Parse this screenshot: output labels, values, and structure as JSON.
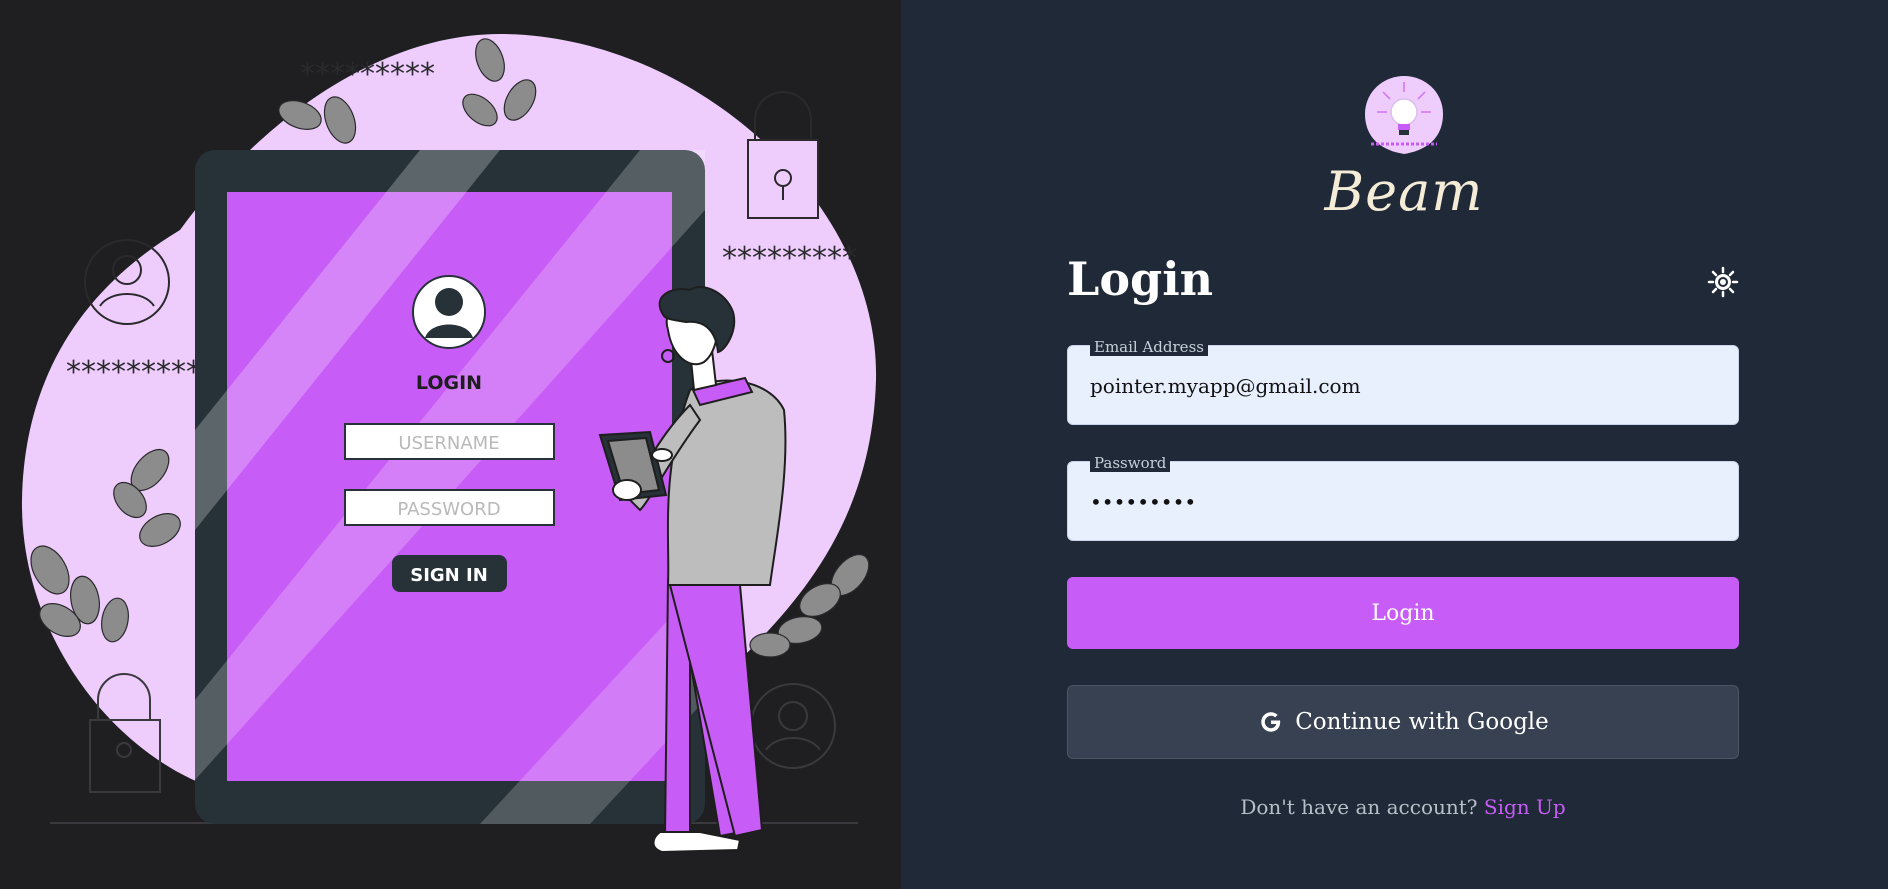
{
  "brand": {
    "name": "Beam",
    "logo_icon": "lightbulb-logo-icon",
    "accent": "#c85cf7"
  },
  "illustration": {
    "tablet_heading": "LOGIN",
    "username_placeholder": "USERNAME",
    "password_placeholder": "PASSWORD",
    "sign_in_label": "SIGN IN",
    "asterisks": "*********"
  },
  "form": {
    "title": "Login",
    "theme_icon": "sun-icon",
    "email": {
      "label": "Email Address",
      "value": "pointer.myapp@gmail.com"
    },
    "password": {
      "label": "Password",
      "value": "•••••••••"
    },
    "login_button": "Login",
    "google_button": "Continue with Google",
    "google_icon": "google-icon",
    "signup_prompt": "Don't have an account?",
    "signup_link": "Sign Up"
  },
  "colors": {
    "left_bg": "#1f1f22",
    "right_bg": "#1f2937",
    "blob": "#eecdfd",
    "tablet_screen": "#c85cf7",
    "input_bg": "#e8f0fe",
    "google_btn_bg": "#374151"
  }
}
